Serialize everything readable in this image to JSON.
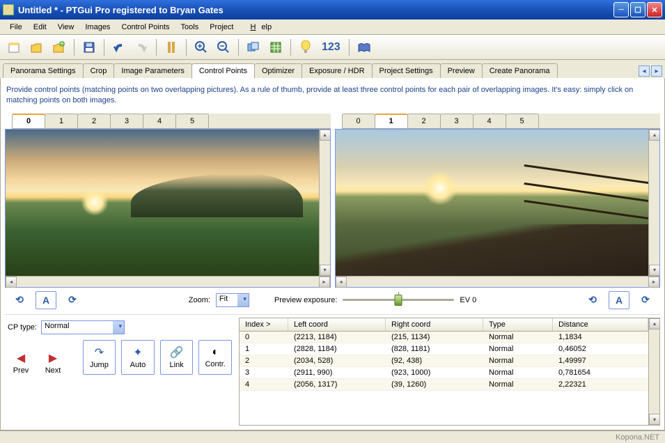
{
  "window": {
    "title": "Untitled * - PTGui Pro registered to Bryan Gates"
  },
  "menu": {
    "file": "File",
    "edit": "Edit",
    "view": "View",
    "images": "Images",
    "controlpoints": "Control Points",
    "tools": "Tools",
    "project": "Project",
    "help": "Help"
  },
  "toolbar": {
    "counter": "123"
  },
  "tabs": [
    "Panorama Settings",
    "Crop",
    "Image Parameters",
    "Control Points",
    "Optimizer",
    "Exposure / HDR",
    "Project Settings",
    "Preview",
    "Create Panorama"
  ],
  "tabs_active": 3,
  "info": "Provide control points (matching points on two overlapping pictures). As a rule of thumb, provide at least three control points for each pair of overlapping images. It's easy: simply click on matching points on both images.",
  "left_tabs": [
    "0",
    "1",
    "2",
    "3",
    "4",
    "5"
  ],
  "left_active": 0,
  "right_tabs": [
    "0",
    "1",
    "2",
    "3",
    "4",
    "5"
  ],
  "right_active": 1,
  "controls": {
    "zoom_label": "Zoom:",
    "zoom_value": "Fit",
    "exposure_label": "Preview exposure:",
    "ev_label": "EV 0",
    "A": "A",
    "cptype_label": "CP type:",
    "cptype_value": "Normal",
    "prev": "Prev",
    "next": "Next",
    "jump": "Jump",
    "auto": "Auto",
    "link": "Link",
    "contr": "Contr."
  },
  "table": {
    "headers": [
      "Index >",
      "Left coord",
      "Right coord",
      "Type",
      "Distance"
    ],
    "rows": [
      {
        "i": "0",
        "l": "(2213, 1184)",
        "r": "(215, 1134)",
        "t": "Normal",
        "d": "1,1834"
      },
      {
        "i": "1",
        "l": "(2828, 1184)",
        "r": "(828, 1181)",
        "t": "Normal",
        "d": "0,46052"
      },
      {
        "i": "2",
        "l": "(2034, 528)",
        "r": "(92, 438)",
        "t": "Normal",
        "d": "1,49997"
      },
      {
        "i": "3",
        "l": "(2911, 990)",
        "r": "(923, 1000)",
        "t": "Normal",
        "d": "0,781654"
      },
      {
        "i": "4",
        "l": "(2056, 1317)",
        "r": "(39, 1260)",
        "t": "Normal",
        "d": "2,22321"
      }
    ]
  },
  "watermark": "Kopona.NET"
}
